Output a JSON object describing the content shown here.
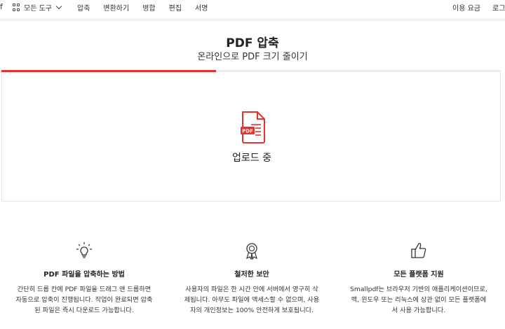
{
  "nav": {
    "left_edge_glyph": "f",
    "tools_label": "모든 도구",
    "links": [
      "압축",
      "변환하기",
      "병합",
      "편집",
      "서명"
    ],
    "pricing_label": "이용 요금",
    "login_label": "로그인"
  },
  "header": {
    "title": "PDF 압축",
    "subtitle": "온라인으로 PDF 크기 줄이기"
  },
  "upload": {
    "progress_fraction": 0.43,
    "status_text": "업로드 중",
    "file_icon_label": "PDF"
  },
  "features": [
    {
      "icon": "lightbulb-icon",
      "title": "PDF 파일을 압축하는 방법",
      "description": "간단히 드롭 칸에 PDF 파일을 드래그 앤 드롭하면 자동으로 압축이 진행됩니다. 작업이 완료되면 압축된 파일은 즉시 다운로드 가능합니다."
    },
    {
      "icon": "award-badge-icon",
      "title": "철저한 보안",
      "description": "사용자의 파일은 한 시간 안에 서버에서 영구히 삭제됩니다. 아무도 파일에 액세스할 수 없으며, 사용자의 개인정보는 100% 안전하게 보호됩니다."
    },
    {
      "icon": "thumbs-up-icon",
      "title": "모든 플랫폼 지원",
      "description": "Smallpdf는 브라우저 기반의 애플리케이션이므로, 맥, 윈도우 또는 리눅스에 상관 없이 모든 플랫폼에서 사용 가능합니다."
    }
  ],
  "colors": {
    "accent": "#e5322d",
    "progress_track": "#ececec",
    "text": "#222222"
  }
}
